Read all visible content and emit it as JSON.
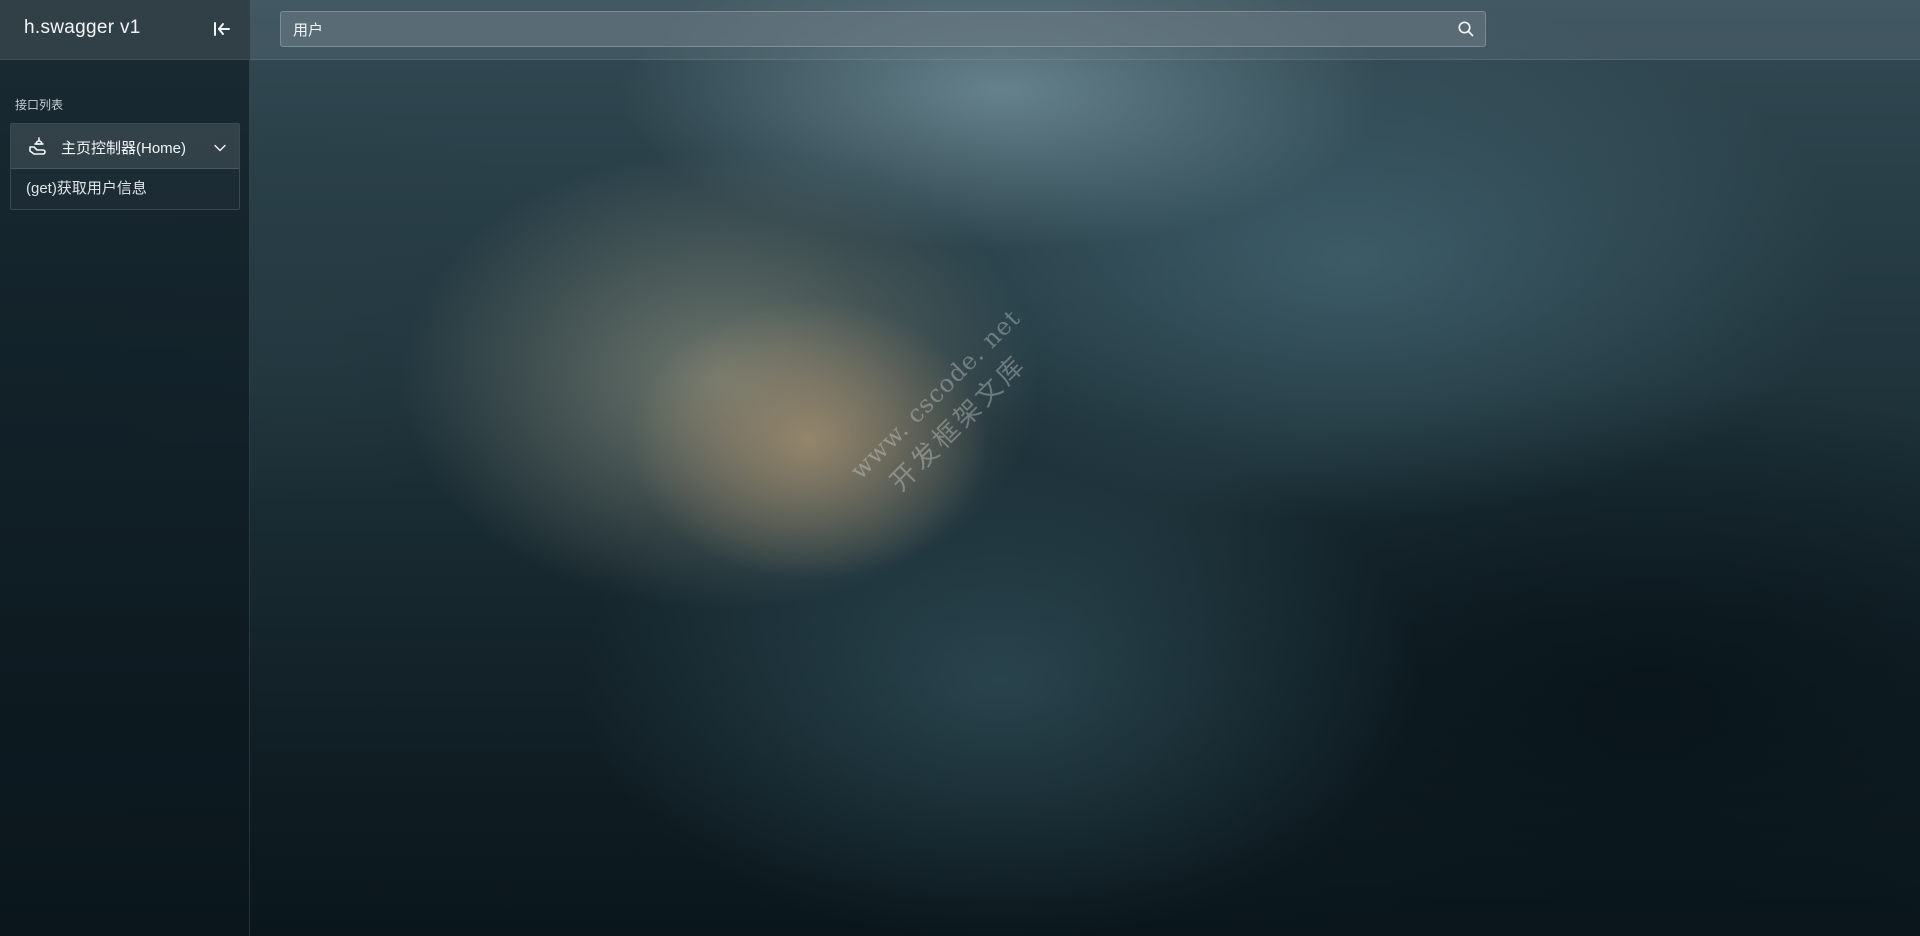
{
  "app": {
    "title": "h.swagger v1"
  },
  "search": {
    "value": "用户",
    "placeholder": ""
  },
  "sidebar": {
    "section_label": "接口列表",
    "groups": [
      {
        "title": "主页控制器(Home)",
        "icon": "api-group-icon",
        "expanded": true,
        "items": [
          {
            "label": "(get)获取用户信息"
          }
        ]
      }
    ]
  },
  "watermark": {
    "line1": "www. cscode. net",
    "line2": "开发框架文库"
  },
  "colors": {
    "sidebar_bg": "#14242c",
    "text": "#e6ecef"
  }
}
